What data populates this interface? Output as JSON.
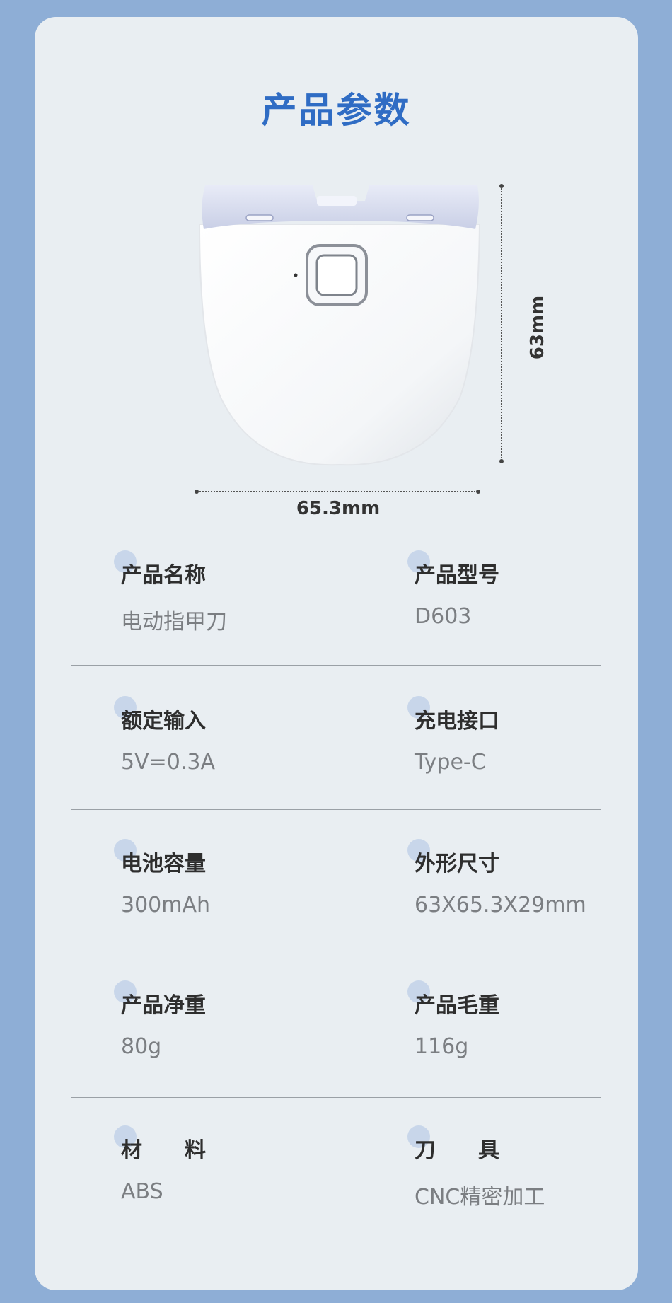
{
  "title": "产品参数",
  "dimensions": {
    "width_label": "65.3mm",
    "height_label": "63mm"
  },
  "specs": [
    {
      "label": "产品名称",
      "value": "电动指甲刀"
    },
    {
      "label": "产品型号",
      "value": "D603"
    },
    {
      "label": "额定输入",
      "value": "5V=0.3A"
    },
    {
      "label": "充电接口",
      "value": "Type-C"
    },
    {
      "label": "电池容量",
      "value": "300mAh"
    },
    {
      "label": "外形尺寸",
      "value": "63X65.3X29mm"
    },
    {
      "label": "产品净重",
      "value": "80g"
    },
    {
      "label": "产品毛重",
      "value": "116g"
    },
    {
      "label": "材　　料",
      "value": "ABS"
    },
    {
      "label": "刀　　具",
      "value": "CNC精密加工"
    }
  ],
  "colors": {
    "background": "#8eaed6",
    "card": "#e9eef2",
    "title": "#2f6cc4",
    "dot": "#c8d6ea"
  }
}
